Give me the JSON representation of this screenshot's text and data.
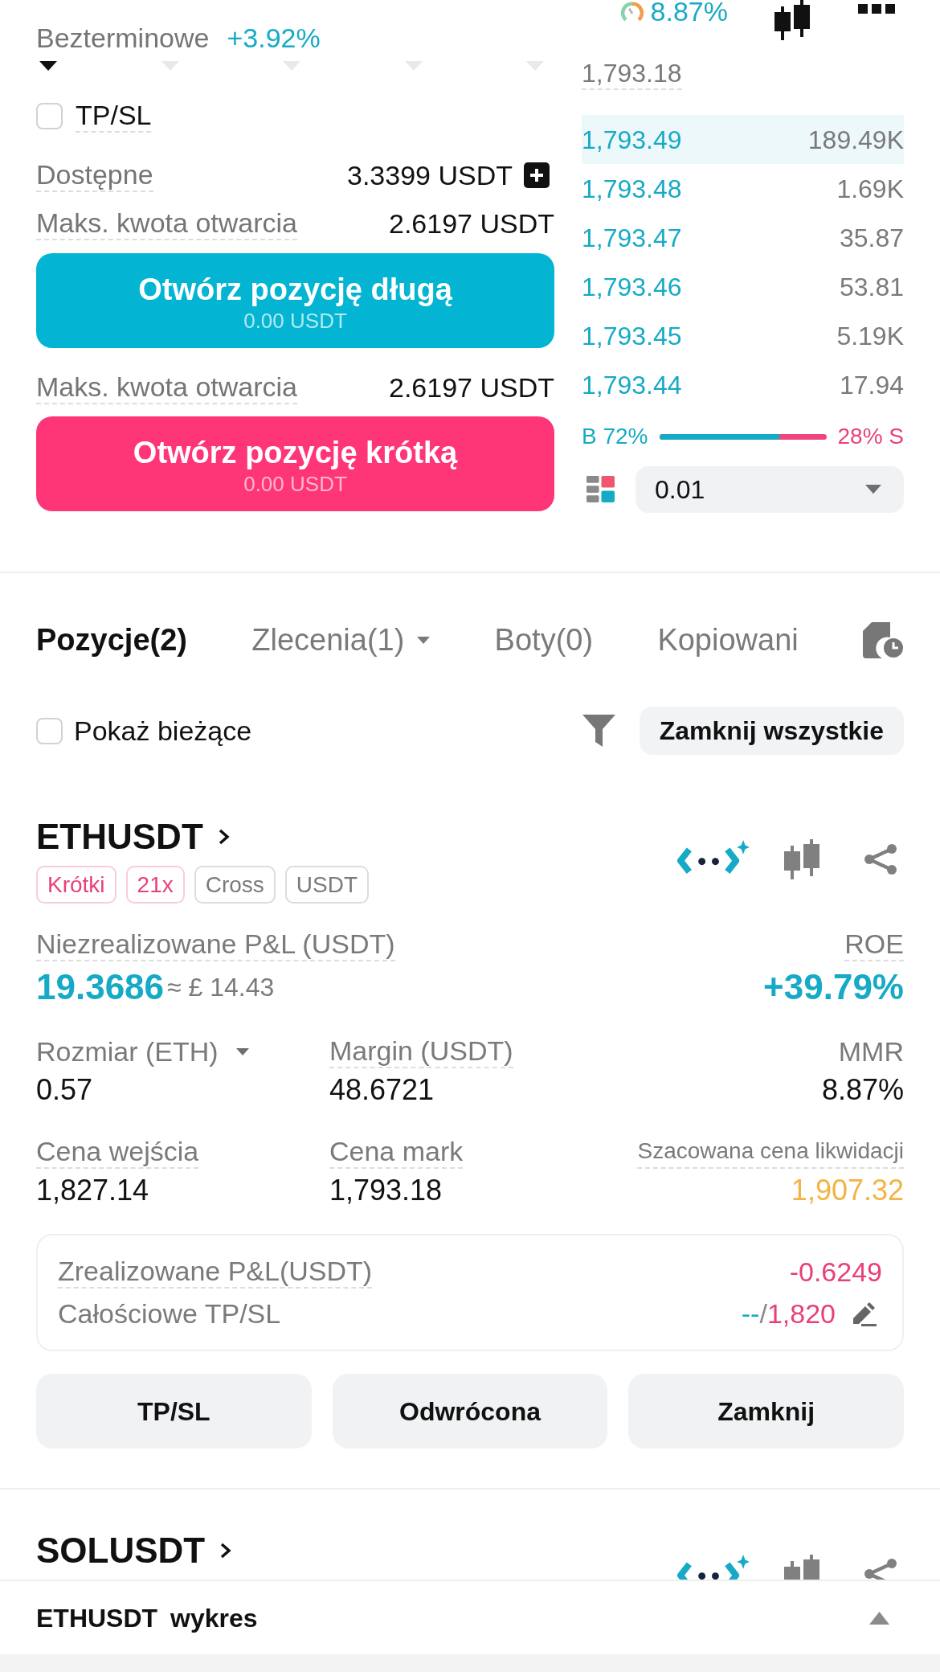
{
  "header": {
    "product_type": "Bezterminowe",
    "change": "+3.92%",
    "risk_rate": "8.87%"
  },
  "order_form": {
    "slider_marks": [
      {
        "selected": true
      },
      {
        "selected": false
      },
      {
        "selected": false
      },
      {
        "selected": false
      },
      {
        "selected": false
      }
    ],
    "tpsl": {
      "label": "TP/SL",
      "checked": false
    },
    "available": {
      "label": "Dostępne",
      "value": "3.3399 USDT"
    },
    "sides": [
      {
        "kind": "long",
        "max_label": "Maks. kwota otwarcia",
        "max_value": "2.6197 USDT",
        "button": "Otwórz pozycję długą",
        "amount": "0.00 USDT"
      },
      {
        "kind": "short",
        "max_label": "Maks. kwota otwarcia",
        "max_value": "2.6197 USDT",
        "button": "Otwórz pozycję krótką",
        "amount": "0.00 USDT"
      }
    ]
  },
  "order_book": {
    "mark_price": "1,793.18",
    "rows": [
      {
        "price": "1,793.49",
        "quantity": "189.49K",
        "highlighted": true
      },
      {
        "price": "1,793.48",
        "quantity": "1.69K",
        "highlighted": false
      },
      {
        "price": "1,793.47",
        "quantity": "35.87",
        "highlighted": false
      },
      {
        "price": "1,793.46",
        "quantity": "53.81",
        "highlighted": false
      },
      {
        "price": "1,793.45",
        "quantity": "5.19K",
        "highlighted": false
      },
      {
        "price": "1,793.44",
        "quantity": "17.94",
        "highlighted": false
      }
    ],
    "buy_ratio": {
      "buy": "B 72%",
      "sell": "28% S",
      "level": 0.72
    },
    "precision": "0.01"
  },
  "tabs": [
    {
      "label": "Pozycje(2)",
      "selected": true,
      "dropdown": false
    },
    {
      "label": "Zlecenia(1)",
      "selected": false,
      "dropdown": true
    },
    {
      "label": "Boty(0)",
      "selected": false,
      "dropdown": false
    },
    {
      "label": "Kopiowani",
      "selected": false,
      "dropdown": false
    }
  ],
  "filters": {
    "show_current": {
      "label": "Pokaż bieżące",
      "checked": false
    },
    "close_all": "Zamknij wszystkie"
  },
  "positions": [
    {
      "symbol": "ETHUSDT",
      "tags": [
        {
          "label": "Krótki",
          "color": "#e8407a"
        },
        {
          "label": "21x",
          "color": "#e8407a"
        },
        {
          "label": "Cross",
          "color": "#7a7a7a"
        },
        {
          "label": "USDT",
          "color": "#7a7a7a"
        }
      ],
      "pnl": {
        "label": "Niezrealizowane P&L (USDT)",
        "value": "19.3686",
        "approx": "≈ £ 14.43"
      },
      "roe": {
        "label": "ROE",
        "value": "+39.79%"
      },
      "stats": [
        {
          "label": "Rozmiar (ETH)",
          "value": "0.57",
          "color": "#121212",
          "has_tooltip": false,
          "dropdown": true
        },
        {
          "label": "Margin (USDT)",
          "value": "48.6721",
          "color": "#121212",
          "has_tooltip": true,
          "dropdown": false
        },
        {
          "label": "MMR",
          "value": "8.87%",
          "color": "#121212",
          "has_tooltip": false,
          "dropdown": false
        },
        {
          "label": "Cena wejścia",
          "value": "1,827.14",
          "color": "#121212",
          "has_tooltip": true,
          "dropdown": false
        },
        {
          "label": "Cena mark",
          "value": "1,793.18",
          "color": "#121212",
          "has_tooltip": true,
          "dropdown": false
        },
        {
          "label": "Szacowana cena likwidacji",
          "value": "1,907.32",
          "color": "#f2b445",
          "has_tooltip": true,
          "dropdown": false
        }
      ],
      "summary": {
        "realized": {
          "label": "Zrealizowane P&L(USDT)",
          "value": "-0.6249",
          "color": "#e8407a"
        },
        "tpsl": {
          "label": "Całościowe TP/SL",
          "take_profit": "--",
          "separator": "/",
          "stop_loss": "1,820"
        }
      },
      "actions": [
        "TP/SL",
        "Odwrócona",
        "Zamknij"
      ]
    },
    {
      "symbol": "SOLUSDT"
    }
  ],
  "bottom_bar": {
    "symbol": "ETHUSDT",
    "label": "wykres"
  }
}
